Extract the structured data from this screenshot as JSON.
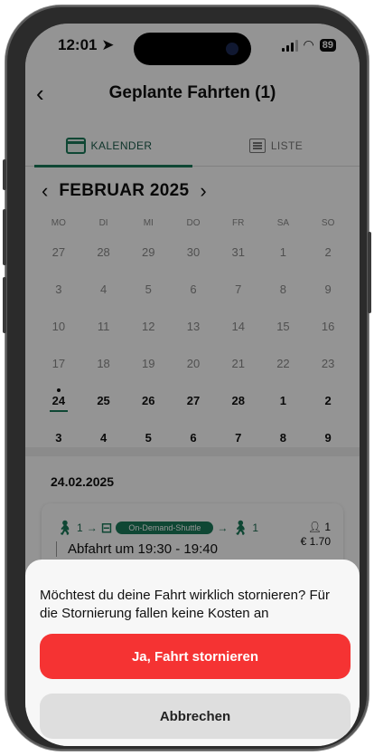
{
  "status_bar": {
    "time": "12:01",
    "battery": "89"
  },
  "header": {
    "title": "Geplante Fahrten (1)"
  },
  "tabs": {
    "calendar": "KALENDER",
    "list": "LISTE"
  },
  "calendar": {
    "month_label": "FEBRUAR 2025",
    "weekdays": [
      "MO",
      "DI",
      "MI",
      "DO",
      "FR",
      "SA",
      "SO"
    ],
    "weeks": [
      [
        "27",
        "28",
        "29",
        "30",
        "31",
        "1",
        "2"
      ],
      [
        "3",
        "4",
        "5",
        "6",
        "7",
        "8",
        "9"
      ],
      [
        "10",
        "11",
        "12",
        "13",
        "14",
        "15",
        "16"
      ],
      [
        "17",
        "18",
        "19",
        "20",
        "21",
        "22",
        "23"
      ],
      [
        "24",
        "25",
        "26",
        "27",
        "28",
        "1",
        "2"
      ],
      [
        "3",
        "4",
        "5",
        "6",
        "7",
        "8",
        "9"
      ]
    ],
    "selected_day": "24"
  },
  "trip": {
    "date": "24.02.2025",
    "walk_start": "1",
    "shuttle_label": "On-Demand-Shuttle",
    "walk_end": "1",
    "passengers": "1",
    "price": "€ 1.70",
    "departure": "Abfahrt um 19:30 - 19:40"
  },
  "dialog": {
    "message": "Möchtest du deine Fahrt wirklich stornieren? Für die Stornierung fallen keine Kosten an",
    "confirm_label": "Ja, Fahrt stornieren",
    "cancel_label": "Abbrechen"
  },
  "colors": {
    "accent": "#1b7a5a",
    "danger": "#f53333"
  }
}
